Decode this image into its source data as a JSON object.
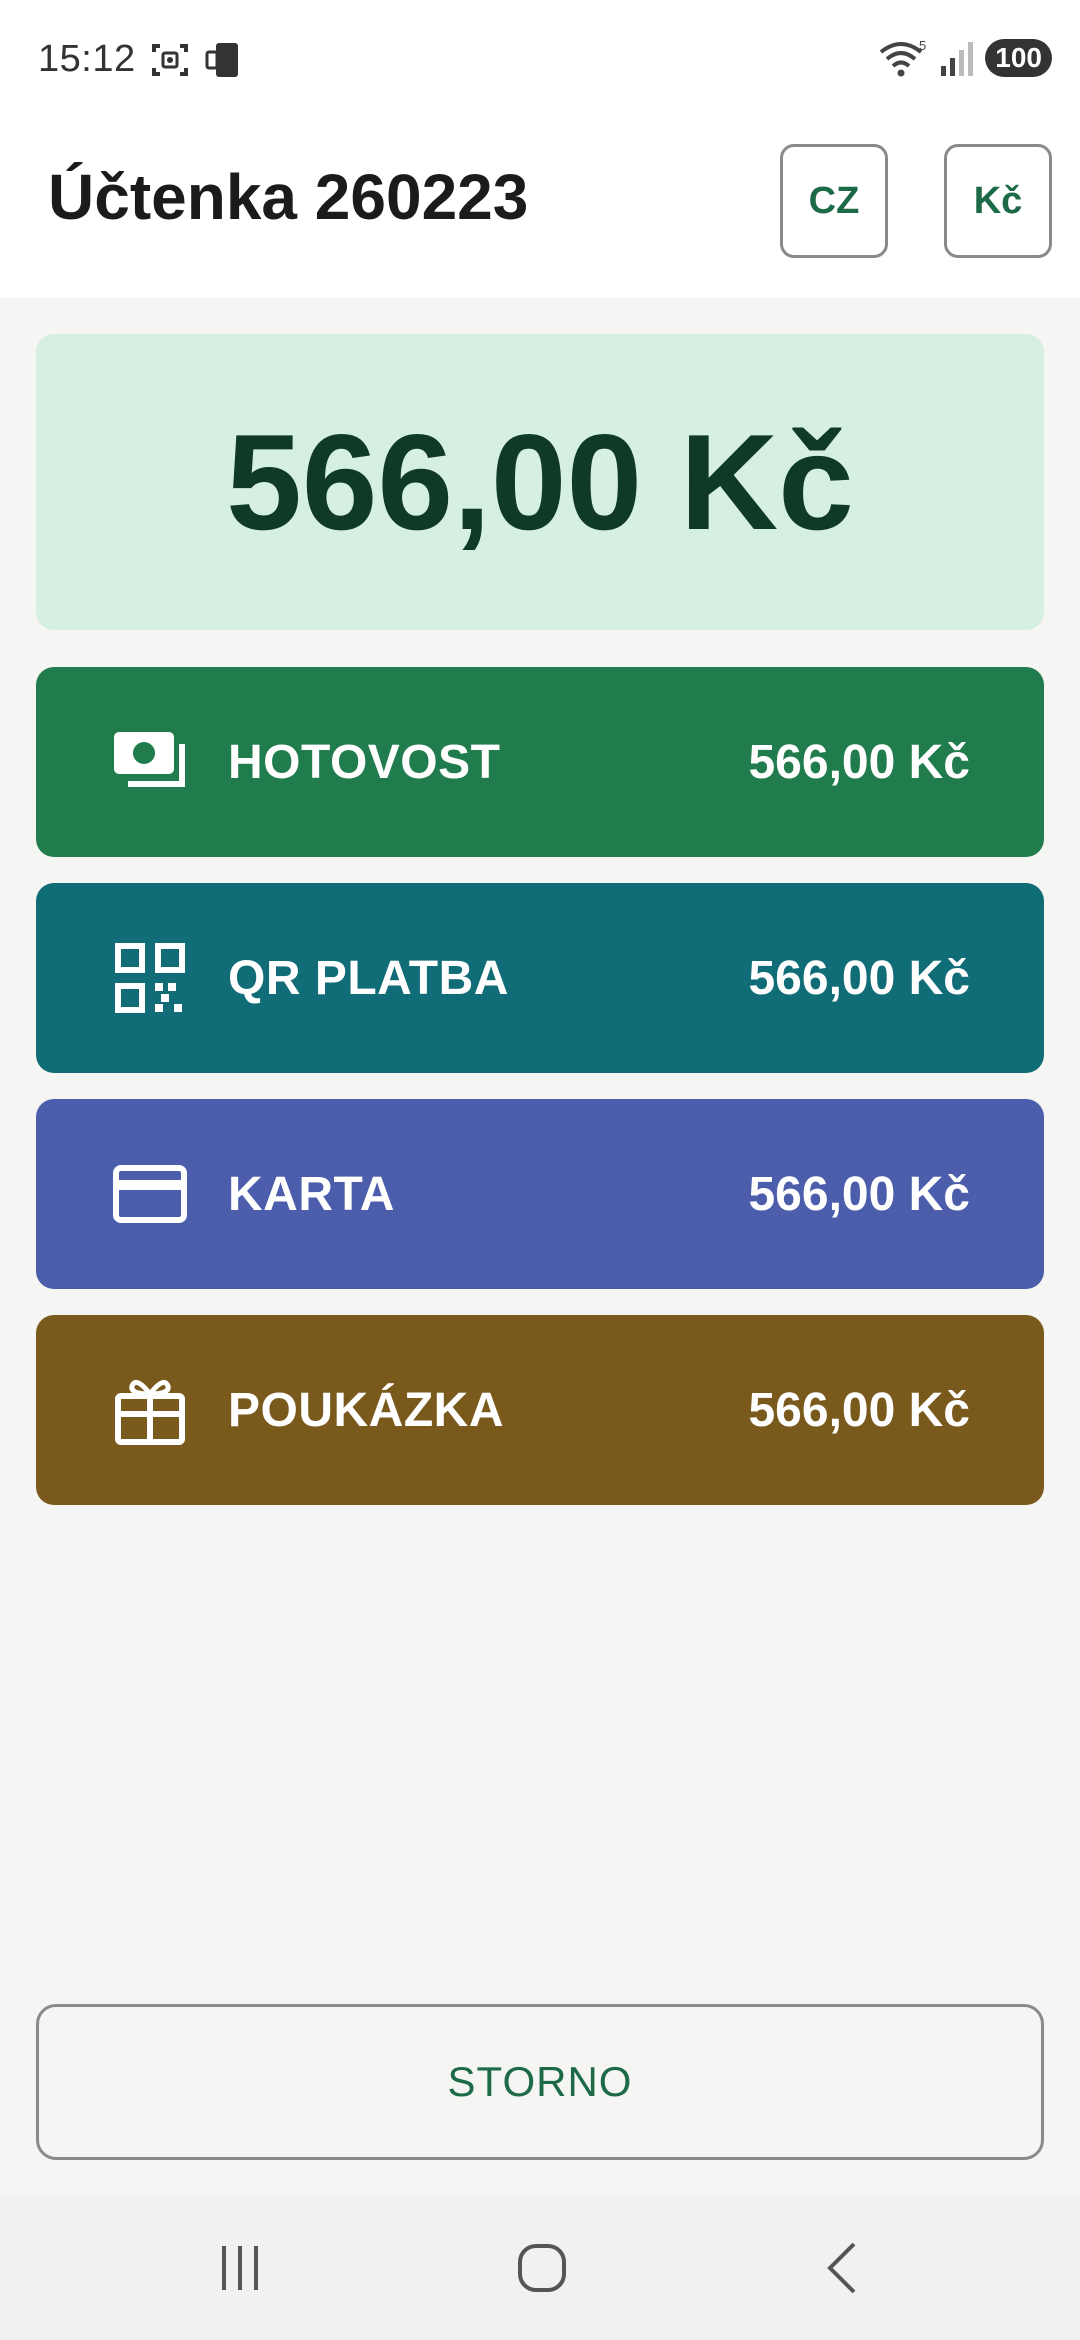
{
  "status_bar": {
    "time": "15:12",
    "battery": "100",
    "icons": [
      "screenshot-icon",
      "phone-icon",
      "wifi-icon",
      "signal-icon",
      "battery-icon"
    ]
  },
  "header": {
    "title": "Účtenka 260223",
    "language_button": "CZ",
    "currency_button": "Kč"
  },
  "total": {
    "amount": "566,00 Kč"
  },
  "payment_methods": [
    {
      "label": "HOTOVOST",
      "amount": "566,00 Kč",
      "icon": "cash-icon",
      "color": "#217c4d"
    },
    {
      "label": "QR PLATBA",
      "amount": "566,00 Kč",
      "icon": "qr-code-icon",
      "color": "#106d78"
    },
    {
      "label": "KARTA",
      "amount": "566,00 Kč",
      "icon": "credit-card-icon",
      "color": "#4b5dab"
    },
    {
      "label": "POUKÁZKA",
      "amount": "566,00 Kč",
      "icon": "gift-icon",
      "color": "#7a5a1c"
    }
  ],
  "footer": {
    "storno_label": "STORNO"
  },
  "nav": {
    "items": [
      "recents-icon",
      "home-icon",
      "back-icon"
    ]
  },
  "colors": {
    "accent": "#1d6a47",
    "total_background": "#d6efe3",
    "total_text": "#0f3a25"
  }
}
